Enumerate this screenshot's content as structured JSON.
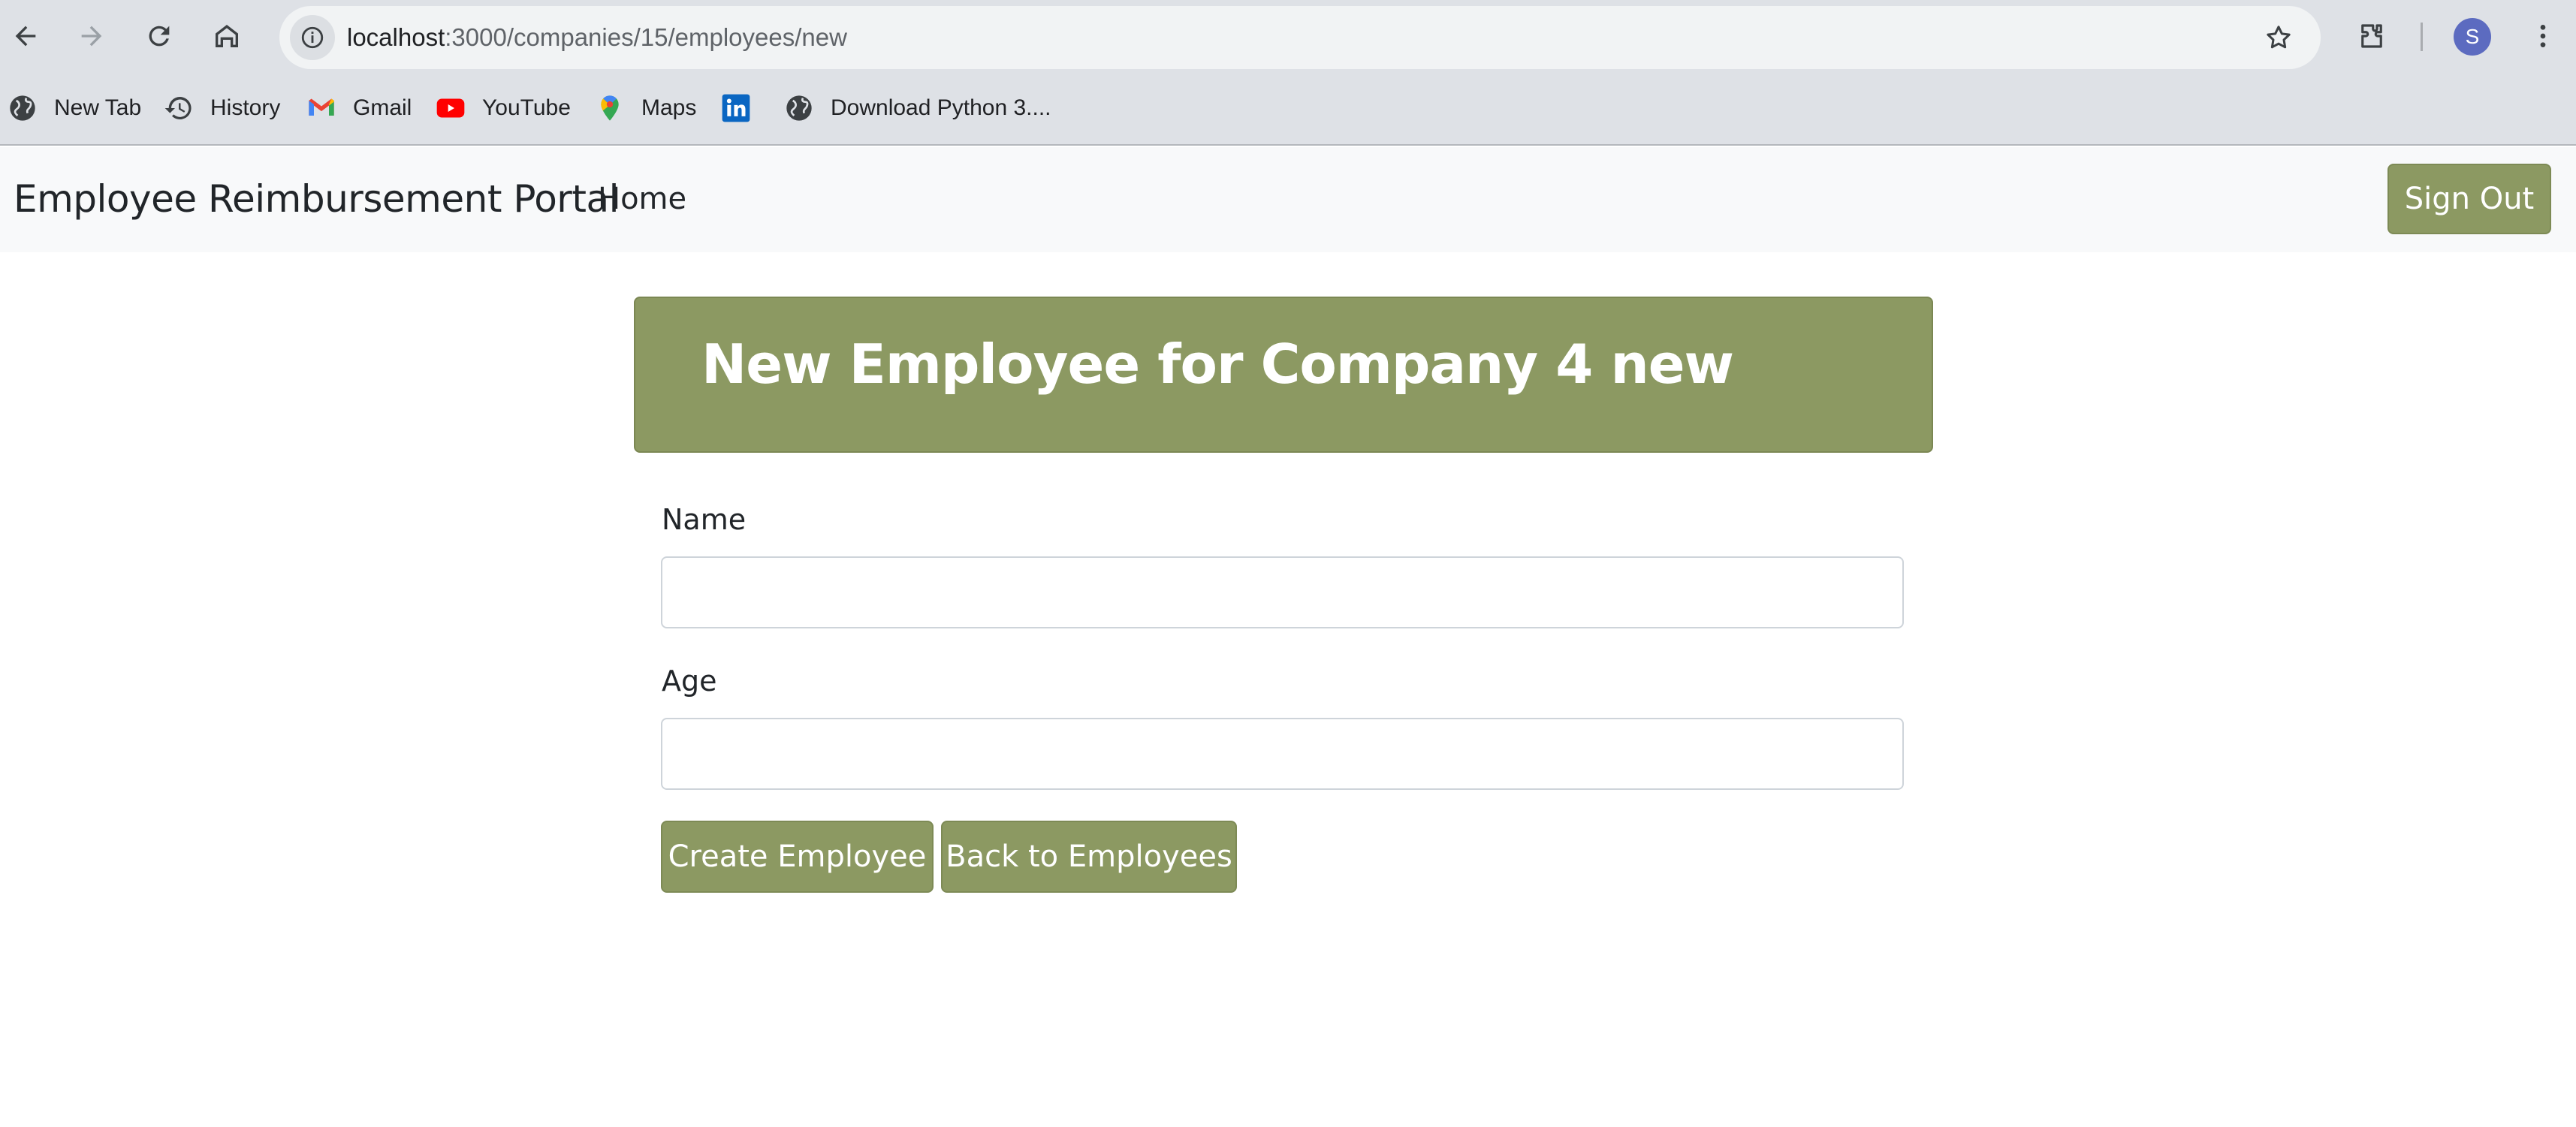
{
  "browser": {
    "url_host": "localhost",
    "url_path": ":3000/companies/15/employees/new",
    "profile_initial": "S"
  },
  "bookmarks": [
    {
      "label": "New Tab",
      "icon": "globe-icon"
    },
    {
      "label": "History",
      "icon": "history-icon"
    },
    {
      "label": "Gmail",
      "icon": "gmail-icon"
    },
    {
      "label": "YouTube",
      "icon": "youtube-icon"
    },
    {
      "label": "Maps",
      "icon": "maps-icon"
    },
    {
      "label": "",
      "icon": "linkedin-icon"
    },
    {
      "label": "Download Python 3....",
      "icon": "globe-icon"
    }
  ],
  "navbar": {
    "brand": "Employee Reimbursement Portal",
    "home": "Home",
    "sign_out": "Sign Out"
  },
  "page": {
    "title": "New Employee for Company 4 new"
  },
  "form": {
    "name_label": "Name",
    "name_value": "",
    "age_label": "Age",
    "age_value": "",
    "submit_label": "Create Employee",
    "back_label": "Back to Employees"
  },
  "colors": {
    "accent": "#8c9962",
    "navbar_bg": "#f8f9fa",
    "chrome_bg": "#dee1e6"
  }
}
